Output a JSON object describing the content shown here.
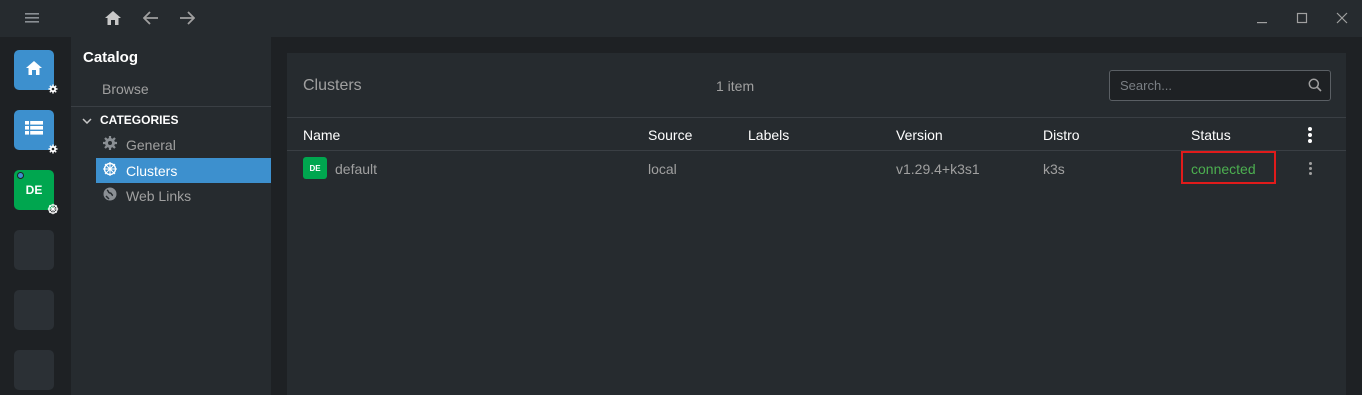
{
  "sidebar": {
    "title": "Catalog",
    "browse": "Browse",
    "categories_label": "CATEGORIES",
    "items": [
      {
        "label": "General",
        "icon": "gear-icon"
      },
      {
        "label": "Clusters",
        "icon": "kubernetes-wheel-icon",
        "active": true
      },
      {
        "label": "Web Links",
        "icon": "globe-icon"
      }
    ]
  },
  "hotbar": {
    "items": [
      {
        "icon": "home-icon",
        "badge": "gear-icon"
      },
      {
        "icon": "catalog-list-icon",
        "badge": "gear-icon"
      },
      {
        "label": "DE",
        "badge": "kubernetes-wheel-icon"
      }
    ]
  },
  "main": {
    "title": "Clusters",
    "count": "1 item",
    "search_placeholder": "Search...",
    "columns": [
      "Name",
      "Source",
      "Labels",
      "Version",
      "Distro",
      "Status"
    ],
    "rows": [
      {
        "avatar": "DE",
        "name": "default",
        "source": "local",
        "labels": "",
        "version": "v1.29.4+k3s1",
        "distro": "k3s",
        "status": "connected"
      }
    ]
  },
  "colors": {
    "accent": "#3d90ce",
    "cluster_avatar": "#00a64f",
    "status_connected": "#4caf50",
    "highlight_box": "#e01b1b"
  }
}
